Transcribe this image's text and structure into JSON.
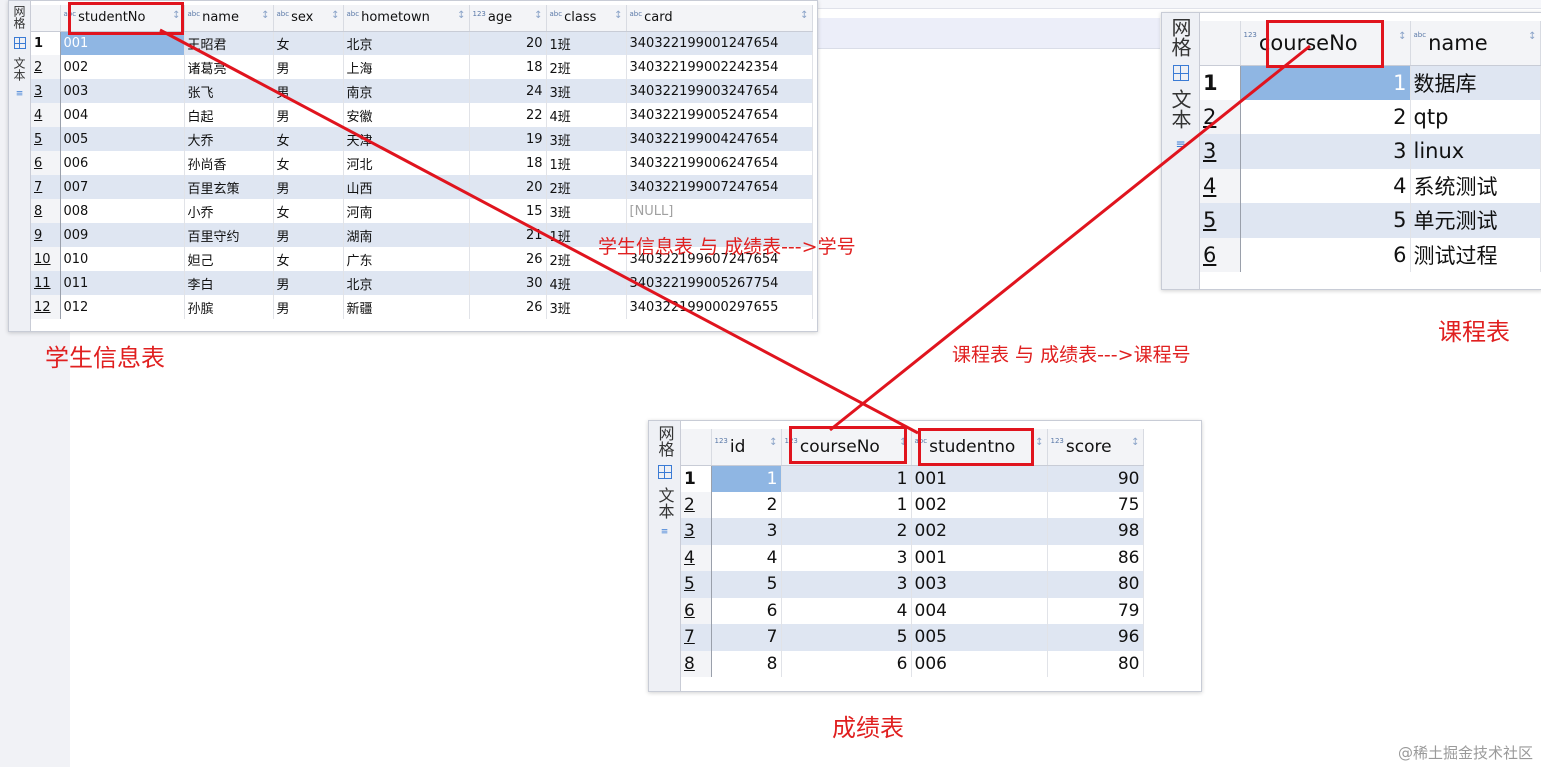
{
  "side_tabs": {
    "grid": "网格",
    "text": "文本"
  },
  "students": {
    "columns": [
      {
        "type": "abc",
        "name": "studentNo"
      },
      {
        "type": "abc",
        "name": "name"
      },
      {
        "type": "abc",
        "name": "sex"
      },
      {
        "type": "abc",
        "name": "hometown"
      },
      {
        "type": "123",
        "name": "age"
      },
      {
        "type": "abc",
        "name": "class"
      },
      {
        "type": "abc",
        "name": "card"
      }
    ],
    "rows": [
      [
        "1",
        "001",
        "王昭君",
        "女",
        "北京",
        "20",
        "1班",
        "340322199001247654"
      ],
      [
        "2",
        "002",
        "诸葛亮",
        "男",
        "上海",
        "18",
        "2班",
        "340322199002242354"
      ],
      [
        "3",
        "003",
        "张飞",
        "男",
        "南京",
        "24",
        "3班",
        "340322199003247654"
      ],
      [
        "4",
        "004",
        "白起",
        "男",
        "安徽",
        "22",
        "4班",
        "340322199005247654"
      ],
      [
        "5",
        "005",
        "大乔",
        "女",
        "天津",
        "19",
        "3班",
        "340322199004247654"
      ],
      [
        "6",
        "006",
        "孙尚香",
        "女",
        "河北",
        "18",
        "1班",
        "340322199006247654"
      ],
      [
        "7",
        "007",
        "百里玄策",
        "男",
        "山西",
        "20",
        "2班",
        "340322199007247654"
      ],
      [
        "8",
        "008",
        "小乔",
        "女",
        "河南",
        "15",
        "3班",
        "[NULL]"
      ],
      [
        "9",
        "009",
        "百里守约",
        "男",
        "湖南",
        "21",
        "1班",
        ""
      ],
      [
        "10",
        "010",
        "妲己",
        "女",
        "广东",
        "26",
        "2班",
        "340322199607247654"
      ],
      [
        "11",
        "011",
        "李白",
        "男",
        "北京",
        "30",
        "4班",
        "340322199005267754"
      ],
      [
        "12",
        "012",
        "孙膑",
        "男",
        "新疆",
        "26",
        "3班",
        "340322199000297655"
      ]
    ],
    "caption": "学生信息表"
  },
  "courses": {
    "columns": [
      {
        "type": "123",
        "name": "courseNo"
      },
      {
        "type": "abc",
        "name": "name"
      }
    ],
    "rows": [
      [
        "1",
        "1",
        "数据库"
      ],
      [
        "2",
        "2",
        "qtp"
      ],
      [
        "3",
        "3",
        "linux"
      ],
      [
        "4",
        "4",
        "系统测试"
      ],
      [
        "5",
        "5",
        "单元测试"
      ],
      [
        "6",
        "6",
        "测试过程"
      ]
    ],
    "caption": "课程表"
  },
  "scores": {
    "columns": [
      {
        "type": "123",
        "name": "id"
      },
      {
        "type": "123",
        "name": "courseNo"
      },
      {
        "type": "abc",
        "name": "studentno"
      },
      {
        "type": "123",
        "name": "score"
      }
    ],
    "rows": [
      [
        "1",
        "1",
        "1",
        "001",
        "90"
      ],
      [
        "2",
        "2",
        "1",
        "002",
        "75"
      ],
      [
        "3",
        "3",
        "2",
        "002",
        "98"
      ],
      [
        "4",
        "4",
        "3",
        "001",
        "86"
      ],
      [
        "5",
        "5",
        "3",
        "003",
        "80"
      ],
      [
        "6",
        "6",
        "4",
        "004",
        "79"
      ],
      [
        "7",
        "7",
        "5",
        "005",
        "96"
      ],
      [
        "8",
        "8",
        "6",
        "006",
        "80"
      ]
    ],
    "caption": "成绩表"
  },
  "annotations": {
    "student_relation": "学生信息表 与 成绩表--->学号",
    "course_relation": "课程表 与 成绩表--->课程号"
  },
  "watermark": "@稀土掘金技术社区",
  "colors": {
    "annotation": "#e02020",
    "selected_cell": "#8fb6e3",
    "alt_row": "#dfe6f2"
  }
}
